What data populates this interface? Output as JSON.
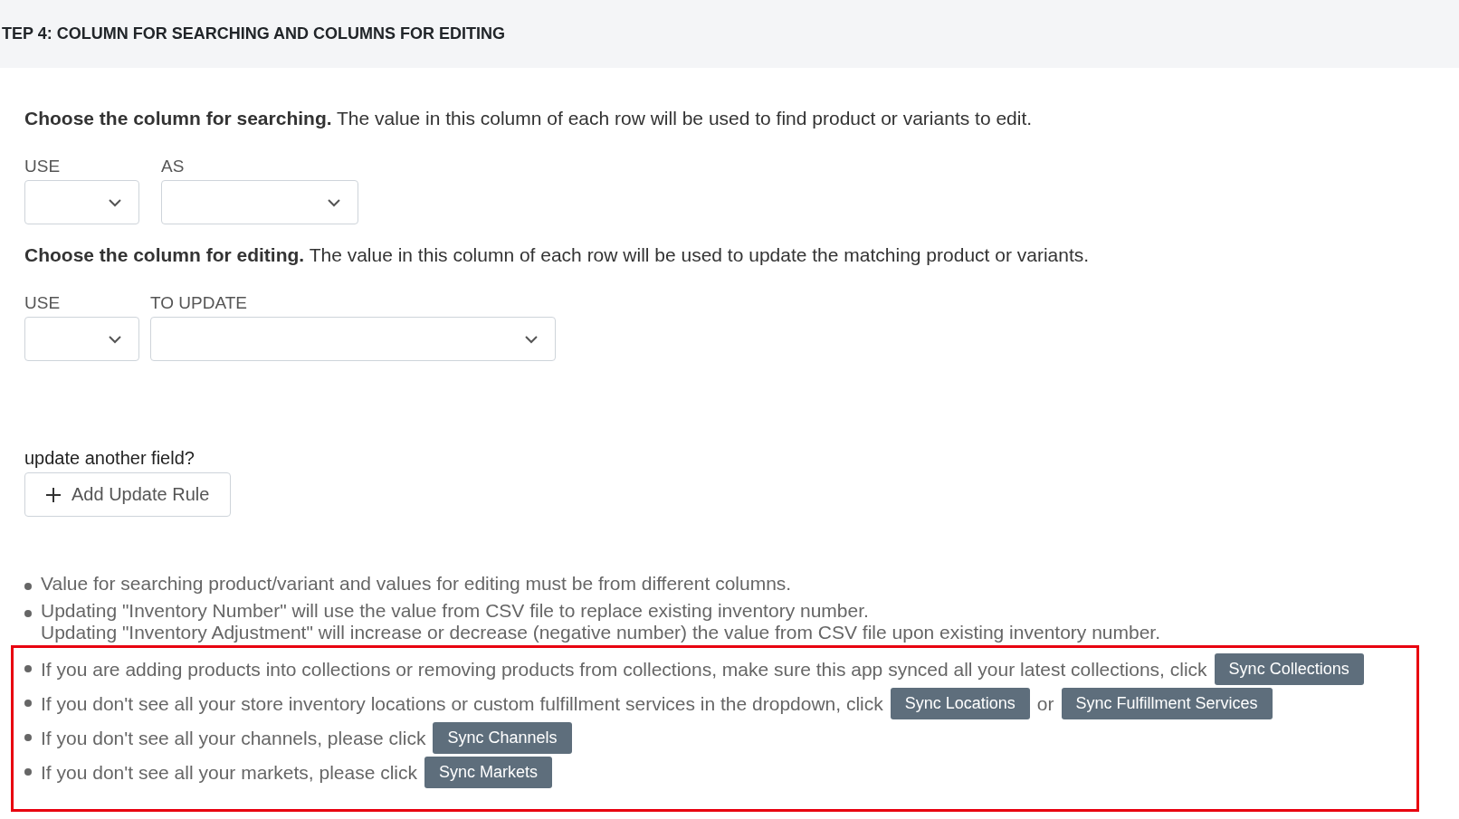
{
  "header": {
    "title": "TEP 4: COLUMN FOR SEARCHING AND COLUMNS FOR EDITING"
  },
  "search_section": {
    "intro": "**Choose the column for searching.** The value in this column of each row will be used to find product or variants to edit.",
    "fields": [
      {
        "label": "USE",
        "kind": "narrow"
      },
      {
        "label": "AS",
        "kind": "medium"
      }
    ]
  },
  "edit_section": {
    "intro": "**Choose the column for editing.** The value in this column of each row will be used to update the matching product or variants.",
    "fields": [
      {
        "label": "USE",
        "kind": "narrow"
      },
      {
        "label": "TO UPDATE",
        "kind": "wide"
      }
    ]
  },
  "add_rule": {
    "prompt": "update another field?",
    "button": "Add Update Rule"
  },
  "notes": [
    {
      "highlighted": false,
      "segments": [
        {
          "kind": "text",
          "text": "Value for searching product/variant and values for editing must be from different columns."
        }
      ]
    },
    {
      "highlighted": false,
      "segments": [
        {
          "kind": "text",
          "text": "Updating \"Inventory Number\" will use the value from CSV file to replace existing inventory number."
        }
      ],
      "continuation": "Updating \"Inventory Adjustment\" will increase or decrease (negative number) the value from CSV file upon existing inventory number."
    },
    {
      "highlighted": true,
      "segments": [
        {
          "kind": "text",
          "text": "If you are adding products into collections or removing products from collections, make sure this app synced all your latest collections, click"
        },
        {
          "kind": "button",
          "text": "Sync Collections"
        }
      ]
    },
    {
      "highlighted": true,
      "segments": [
        {
          "kind": "text",
          "text": "If you don't see all your store inventory locations or custom fulfillment services in the dropdown, click"
        },
        {
          "kind": "button",
          "text": "Sync Locations"
        },
        {
          "kind": "text",
          "text": "or"
        },
        {
          "kind": "button",
          "text": "Sync Fulfillment Services"
        }
      ]
    },
    {
      "highlighted": true,
      "segments": [
        {
          "kind": "text",
          "text": "If you don't see all your channels, please click"
        },
        {
          "kind": "button",
          "text": "Sync Channels"
        }
      ]
    },
    {
      "highlighted": true,
      "segments": [
        {
          "kind": "text",
          "text": "If you don't see all your markets, please click"
        },
        {
          "kind": "button",
          "text": "Sync Markets"
        }
      ]
    }
  ]
}
